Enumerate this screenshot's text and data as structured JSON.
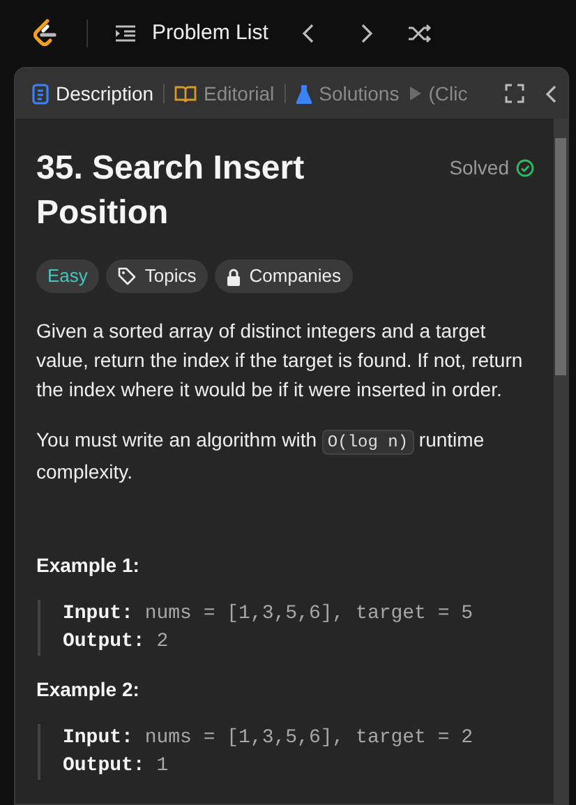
{
  "topbar": {
    "title": "Problem List"
  },
  "tabs": [
    {
      "label": "Description",
      "selected": true,
      "kind": "description"
    },
    {
      "label": "Editorial",
      "selected": false,
      "kind": "editorial"
    },
    {
      "label": "Solutions",
      "selected": false,
      "kind": "solutions"
    },
    {
      "label": "(Clic",
      "selected": false,
      "kind": "more"
    }
  ],
  "problem": {
    "title": "35. Search Insert Position",
    "status": "Solved",
    "solved": true,
    "chips": [
      {
        "label": "Easy",
        "kind": "difficulty"
      },
      {
        "label": "Topics",
        "kind": "topics"
      },
      {
        "label": "Companies",
        "kind": "companies"
      }
    ],
    "paragraphs": [
      {
        "before": "Given a sorted array of distinct integers and a target value, return the index if the target is found. If not, return the index where it would be if it were inserted in order."
      },
      {
        "before": "You must write an algorithm with ",
        "code": "O(log n)",
        "after": " runtime complexity."
      }
    ],
    "examples": [
      {
        "heading": "Example 1:",
        "lines": [
          {
            "label": "Input:",
            "value": "nums = [1,3,5,6], target = 5"
          },
          {
            "label": "Output:",
            "value": "2"
          }
        ]
      },
      {
        "heading": "Example 2:",
        "lines": [
          {
            "label": "Input:",
            "value": "nums = [1,3,5,6], target = 2"
          },
          {
            "label": "Output:",
            "value": "1"
          }
        ]
      }
    ]
  }
}
